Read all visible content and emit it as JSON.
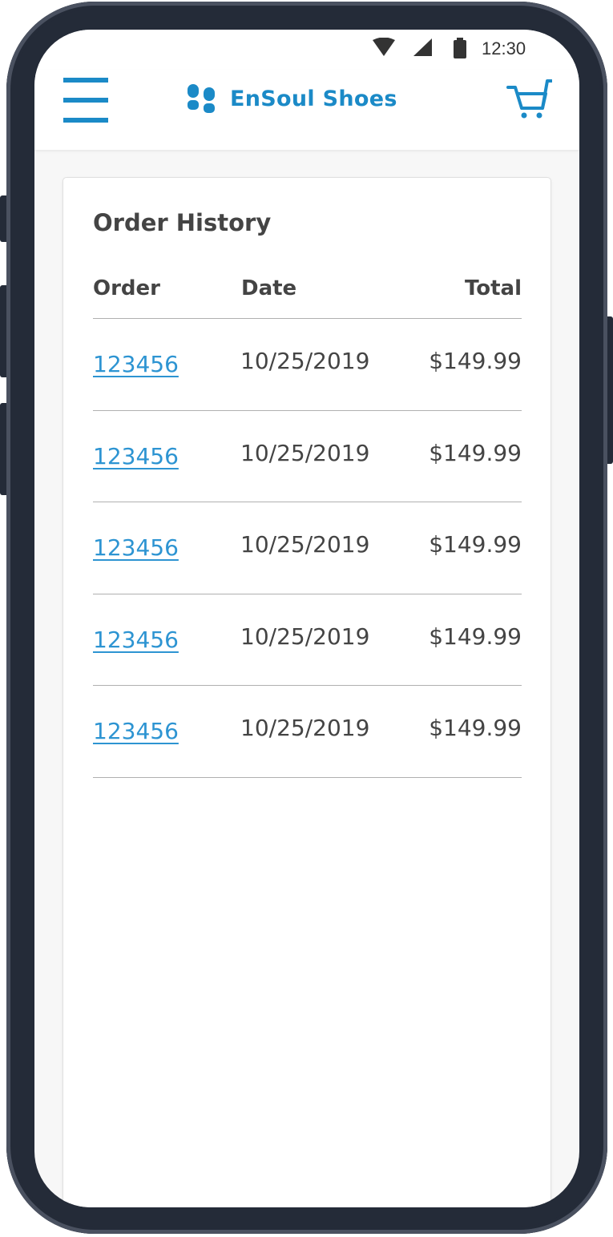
{
  "status_bar": {
    "time": "12:30",
    "icons": [
      "wifi-icon",
      "signal-icon",
      "battery-icon"
    ]
  },
  "header": {
    "brand_name": "EnSoul Shoes",
    "left_icon": "menu-icon",
    "logo_icon": "footprints-logo",
    "right_icon": "cart-icon"
  },
  "colors": {
    "brand": "#1b8ac7",
    "link": "#2d94d2",
    "text": "#444444",
    "frame": "#242b38"
  },
  "order_history": {
    "title": "Order History",
    "columns": {
      "order": "Order",
      "date": "Date",
      "total": "Total"
    },
    "rows": [
      {
        "order": "123456",
        "date": "10/25/2019",
        "total": "$149.99"
      },
      {
        "order": "123456",
        "date": "10/25/2019",
        "total": "$149.99"
      },
      {
        "order": "123456",
        "date": "10/25/2019",
        "total": "$149.99"
      },
      {
        "order": "123456",
        "date": "10/25/2019",
        "total": "$149.99"
      },
      {
        "order": "123456",
        "date": "10/25/2019",
        "total": "$149.99"
      }
    ]
  }
}
